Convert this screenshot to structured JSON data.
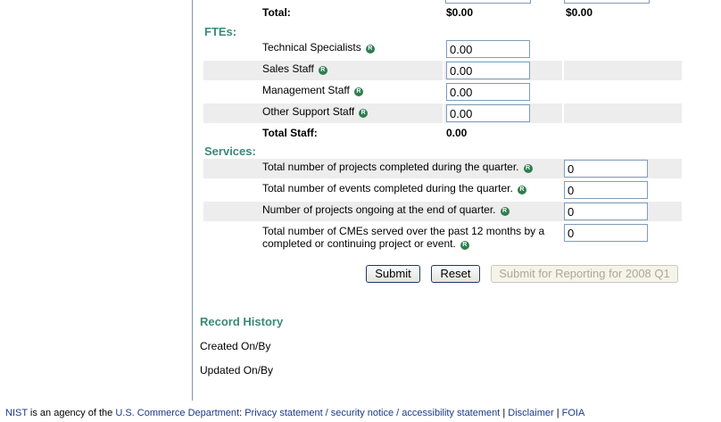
{
  "budget": {
    "total_label": "Total:",
    "total_col1": "$0.00",
    "total_col2": "$0.00"
  },
  "ftes": {
    "heading": "FTEs:",
    "rows": [
      {
        "label": "Technical Specialists",
        "value": "0.00"
      },
      {
        "label": "Sales Staff",
        "value": "0.00"
      },
      {
        "label": "Management Staff",
        "value": "0.00"
      },
      {
        "label": "Other Support Staff",
        "value": "0.00"
      }
    ],
    "total_label": "Total Staff:",
    "total_value": "0.00"
  },
  "services": {
    "heading": "Services:",
    "rows": [
      {
        "label": "Total number of projects completed during the quarter.",
        "value": "0"
      },
      {
        "label": "Total number of events completed during the quarter.",
        "value": "0"
      },
      {
        "label": "Number of projects ongoing at the end of quarter.",
        "value": "0"
      },
      {
        "label_line1": "Total number of CMEs served over the past 12 months by a",
        "label_line2": "completed or continuing project or event.",
        "value": "0"
      }
    ]
  },
  "info_glyph": "R",
  "buttons": {
    "submit": "Submit",
    "reset": "Reset",
    "submit_reporting": "Submit for Reporting for 2008 Q1"
  },
  "record_history": {
    "title": "Record History",
    "created": "Created On/By",
    "updated": "Updated On/By"
  },
  "footer": {
    "nist": "NIST",
    "text1": " is an agency of the ",
    "commerce": "U.S. Commerce Department",
    "sep1": ": ",
    "privacy": "Privacy statement / security notice / accessibility statement",
    "sep2": " | ",
    "disclaimer": "Disclaimer",
    "sep3": " | ",
    "foia": "FOIA"
  },
  "colors": {
    "section_heading": "#3a8a74",
    "info_icon": "#2e7d4f",
    "link": "#1a3a8a",
    "row_shade": "#ededed"
  }
}
